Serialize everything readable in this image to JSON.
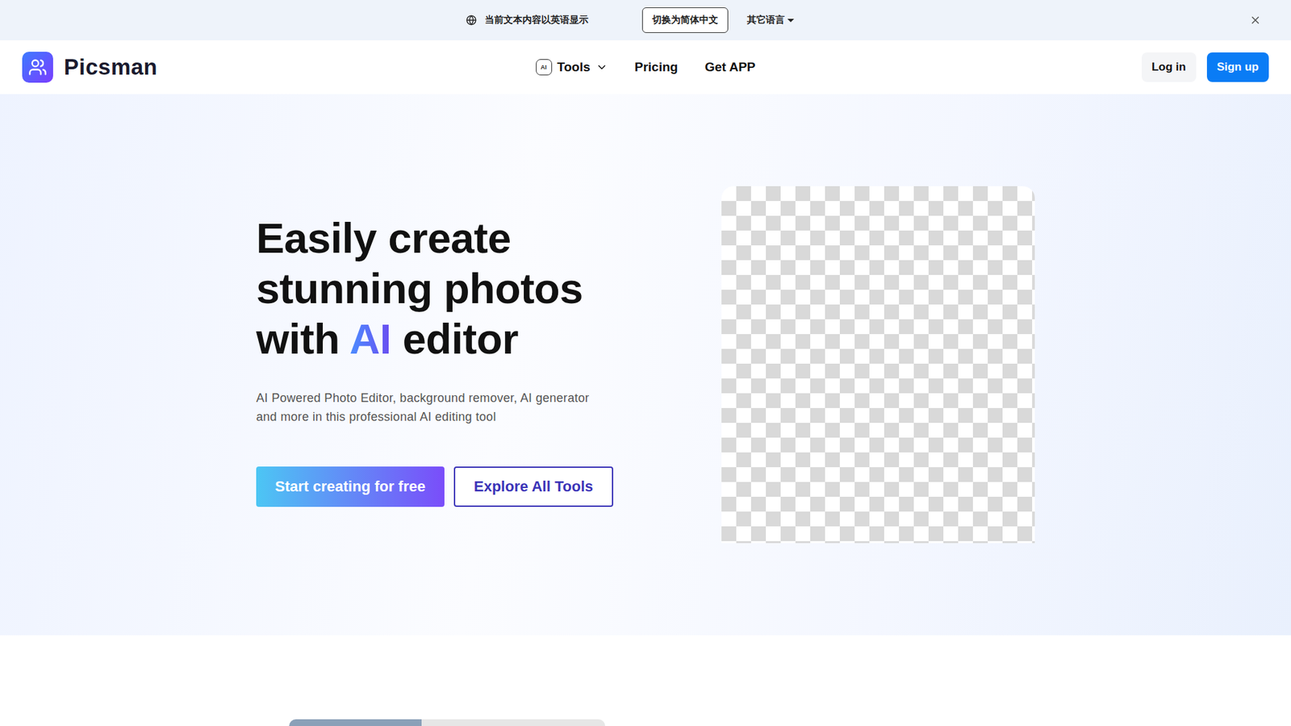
{
  "banner": {
    "notice": "当前文本内容以英语显示",
    "switch_button": "切换为简体中文",
    "language_menu": "其它语言"
  },
  "nav": {
    "brand": "Picsman",
    "links": [
      {
        "label": "Tools",
        "badge": "AI",
        "has_menu": true
      },
      {
        "label": "Pricing",
        "badge": "",
        "has_menu": false
      },
      {
        "label": "Get APP",
        "badge": "",
        "has_menu": false
      }
    ],
    "login": "Log in",
    "signup": "Sign up"
  },
  "hero": {
    "title_lines": [
      [
        {
          "text": "Easily create",
          "highlight": false
        }
      ],
      [
        {
          "text": "stunning photos",
          "highlight": false
        }
      ],
      [
        {
          "text": "with ",
          "highlight": false
        },
        {
          "text": "AI",
          "highlight": true
        },
        {
          "text": " editor",
          "highlight": false
        }
      ]
    ],
    "subtitle_lines": [
      "AI Powered Photo Editor, background remover, AI generator",
      "and more in this professional AI editing tool"
    ],
    "primary_button": "Start creating for free",
    "secondary_button": "Explore All Tools"
  }
}
